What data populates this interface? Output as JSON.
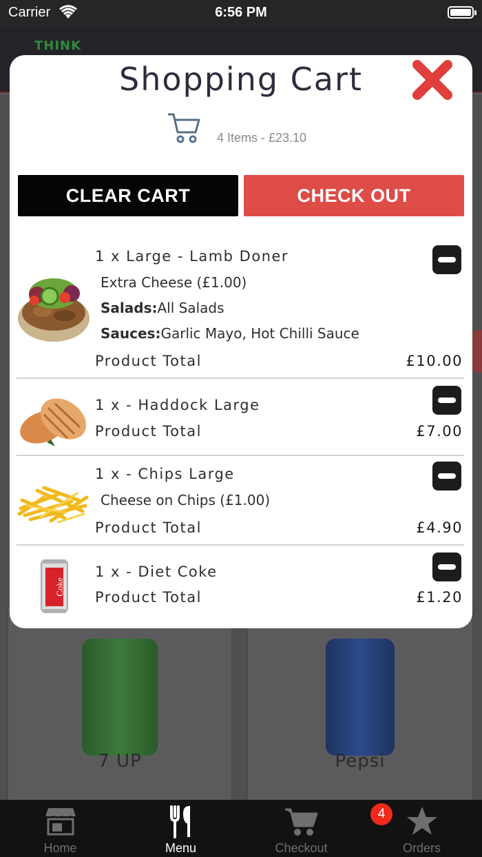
{
  "status_bar": {
    "carrier": "Carrier",
    "time": "6:56 PM"
  },
  "background": {
    "logo_text": "THINK",
    "products": [
      {
        "name": "7 UP"
      },
      {
        "name": "Pepsi"
      }
    ]
  },
  "cart": {
    "title": "Shopping Cart",
    "summary": "4 Items - £23.10",
    "clear_label": "CLEAR CART",
    "checkout_label": "CHECK OUT",
    "items": [
      {
        "line": "1 x Large - Lamb Doner",
        "image": "doner-kebab-image",
        "extra": "Extra Cheese (£1.00)",
        "salads_label": "Salads:",
        "salads_value": "All Salads",
        "sauces_label": "Sauces:",
        "sauces_value": "Garlic Mayo, Hot Chilli Sauce",
        "total_label": "Product Total",
        "price": "£10.00"
      },
      {
        "line": "1 x - Haddock Large",
        "image": "haddock-image",
        "total_label": "Product Total",
        "price": "£7.00"
      },
      {
        "line": "1 x - Chips Large",
        "image": "chips-image",
        "extra": "Cheese on Chips (£1.00)",
        "total_label": "Product Total",
        "price": "£4.90"
      },
      {
        "line": "1 x - Diet Coke",
        "image": "diet-coke-image",
        "total_label": "Product Total",
        "price": "£1.20"
      }
    ]
  },
  "tabbar": {
    "tabs": [
      {
        "label": "Home",
        "icon": "store-icon"
      },
      {
        "label": "Menu",
        "icon": "cutlery-icon"
      },
      {
        "label": "Checkout",
        "icon": "cart-icon",
        "badge": "4"
      },
      {
        "label": "Orders",
        "icon": "star-icon"
      }
    ],
    "active": "Menu"
  },
  "colors": {
    "checkout_button": "#de4c48",
    "clear_button": "#050505",
    "close_icon": "#e03f3b",
    "badge": "#ef2a1b"
  }
}
